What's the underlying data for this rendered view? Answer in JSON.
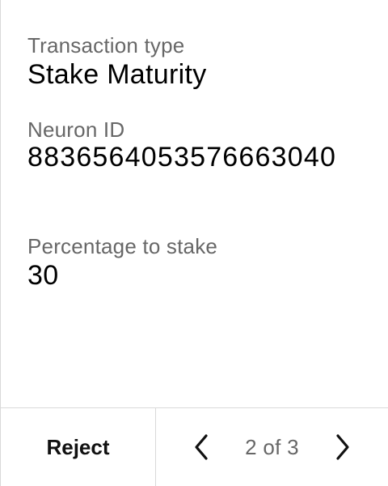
{
  "fields": [
    {
      "label": "Transaction type",
      "value": "Stake Maturity"
    },
    {
      "label": "Neuron ID",
      "value": "8836564053576663040"
    },
    {
      "label": "Percentage to stake",
      "value": "30"
    }
  ],
  "footer": {
    "reject_label": "Reject",
    "page_indicator": "2 of 3",
    "prev_icon": "chevron-left-icon",
    "next_icon": "chevron-right-icon"
  },
  "colors": {
    "label": "#676767",
    "value": "#000000",
    "divider": "#d9d9d9",
    "background": "#ffffff"
  }
}
